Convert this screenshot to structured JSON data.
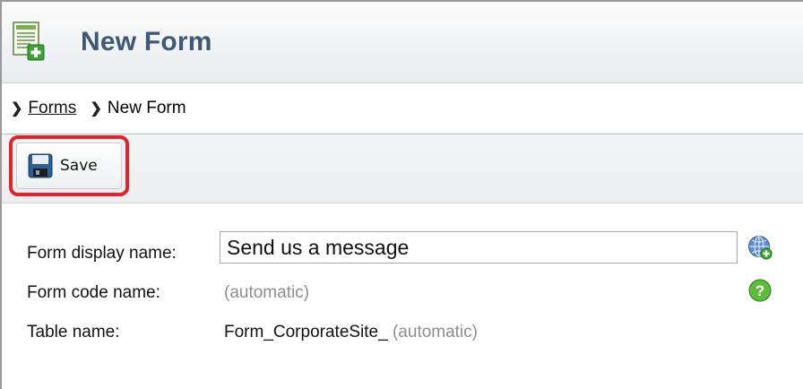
{
  "header": {
    "title": "New Form",
    "icon": "form-add-icon"
  },
  "breadcrumb": {
    "items": [
      {
        "label": "Forms",
        "link": true
      },
      {
        "label": "New Form",
        "link": false
      }
    ]
  },
  "toolbar": {
    "save_label": "Save",
    "save_icon": "floppy-disk-icon",
    "highlight_color": "#e0242a"
  },
  "form": {
    "display_name_label": "Form display name:",
    "display_name_value": "Send us a message",
    "code_name_label": "Form code name:",
    "code_name_value": "(automatic)",
    "table_name_label": "Table name:",
    "table_name_prefix": "Form_CorporateSite_",
    "table_name_suffix": "(automatic)"
  },
  "icons": {
    "localize": "globe-add-icon",
    "help": "help-icon"
  },
  "colors": {
    "title": "#3f5875",
    "automatic_text": "#8e8e8e"
  }
}
